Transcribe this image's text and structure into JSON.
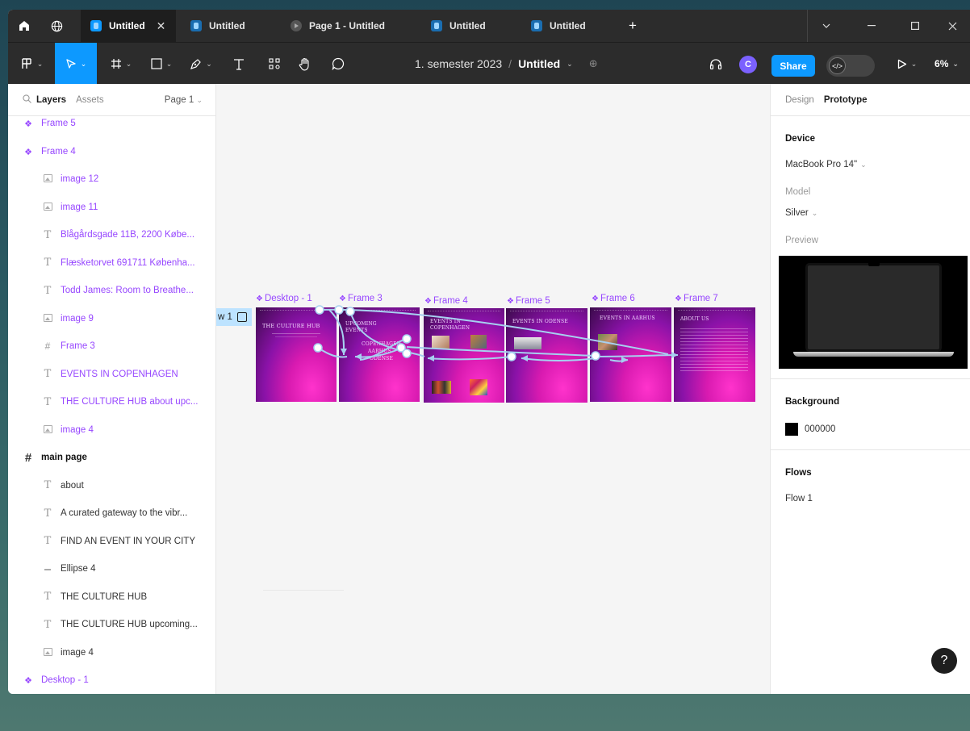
{
  "titlebar": {
    "tabs": [
      {
        "label": "Untitled",
        "active": true,
        "icon": "figma-file-icon"
      },
      {
        "label": "Untitled",
        "active": false,
        "icon": "figma-file-icon"
      },
      {
        "label": "Page 1 - Untitled",
        "active": false,
        "icon": "prototype-play-icon"
      },
      {
        "label": "Untitled",
        "active": false,
        "icon": "figma-file-icon"
      },
      {
        "label": "Untitled",
        "active": false,
        "icon": "figma-file-icon"
      }
    ],
    "close_glyph": "✕",
    "add_glyph": "+"
  },
  "toolbar": {
    "project": "1. semester 2023",
    "separator": "/",
    "file_name": "Untitled",
    "avatar_initial": "C",
    "share_label": "Share",
    "zoom": "6%"
  },
  "left_panel": {
    "tab_layers": "Layers",
    "tab_assets": "Assets",
    "page_selector": "Page 1",
    "layers": [
      {
        "label": "Frame 5",
        "icon": "component-icon",
        "style": "comp",
        "indent": 0
      },
      {
        "label": "Frame 4",
        "icon": "component-icon",
        "style": "comp",
        "indent": 0
      },
      {
        "label": "image 12",
        "icon": "image-icon",
        "style": "child",
        "indent": 1
      },
      {
        "label": "image 11",
        "icon": "image-icon",
        "style": "child",
        "indent": 1
      },
      {
        "label": "Blågårdsgade 11B, 2200 Købe...",
        "icon": "text-icon",
        "style": "child",
        "indent": 1
      },
      {
        "label": "Flæsketorvet 691711 Københa...",
        "icon": "text-icon",
        "style": "child",
        "indent": 1
      },
      {
        "label": "Todd James: Room to Breathe...",
        "icon": "text-icon",
        "style": "child",
        "indent": 1
      },
      {
        "label": "image 9",
        "icon": "image-icon",
        "style": "child",
        "indent": 1
      },
      {
        "label": "Frame 3",
        "icon": "frame-icon",
        "style": "child",
        "indent": 1
      },
      {
        "label": "EVENTS IN COPENHAGEN",
        "icon": "text-icon",
        "style": "child",
        "indent": 1
      },
      {
        "label": "THE CULTURE HUB about upc...",
        "icon": "text-icon",
        "style": "child",
        "indent": 1
      },
      {
        "label": "image 4",
        "icon": "image-icon",
        "style": "child",
        "indent": 1
      },
      {
        "label": "main page",
        "icon": "frame-icon",
        "style": "frame-top",
        "indent": 0
      },
      {
        "label": "about",
        "icon": "text-icon",
        "style": "plain",
        "indent": 1
      },
      {
        "label": "A curated gateway to the vibr...",
        "icon": "text-icon",
        "style": "plain",
        "indent": 1
      },
      {
        "label": "FIND AN EVENT IN YOUR CITY",
        "icon": "text-icon",
        "style": "plain",
        "indent": 1
      },
      {
        "label": "Ellipse 4",
        "icon": "line-icon",
        "style": "plain",
        "indent": 1
      },
      {
        "label": "THE CULTURE HUB",
        "icon": "text-icon",
        "style": "plain",
        "indent": 1
      },
      {
        "label": "THE CULTURE HUB upcoming...",
        "icon": "text-icon",
        "style": "plain",
        "indent": 1
      },
      {
        "label": "image 4",
        "icon": "image-icon",
        "style": "plain",
        "indent": 1
      },
      {
        "label": "Desktop - 1",
        "icon": "component-icon",
        "style": "comp",
        "indent": 0
      }
    ]
  },
  "canvas": {
    "flow_starting_point": "w 1",
    "frames": [
      {
        "label": "Desktop - 1",
        "title": "THE CULTURE HUB"
      },
      {
        "label": "Frame 3",
        "title": "UPCOMING EVENTS"
      },
      {
        "label": "Frame 4",
        "title": "EVENTS IN COPENHAGEN"
      },
      {
        "label": "Frame 5",
        "title": "EVENTS IN ODENSE"
      },
      {
        "label": "Frame 6",
        "title": "EVENTS IN AARHUS"
      },
      {
        "label": "Frame 7",
        "title": "ABOUT US"
      }
    ],
    "frame3_cities": [
      "COPENHAGEN",
      "AARHUS",
      "ODENSE"
    ],
    "connector_color": "#a7d0f0"
  },
  "right_panel": {
    "tab_design": "Design",
    "tab_prototype": "Prototype",
    "device_title": "Device",
    "device_value": "MacBook Pro 14\"",
    "model_label": "Model",
    "model_value": "Silver",
    "preview_label": "Preview",
    "background_title": "Background",
    "background_hex": "000000",
    "flows_title": "Flows",
    "flows": [
      "Flow 1"
    ]
  },
  "help_glyph": "?",
  "colors": {
    "accent": "#0d99ff",
    "component": "#9747ff",
    "chrome": "#2c2c2c"
  }
}
